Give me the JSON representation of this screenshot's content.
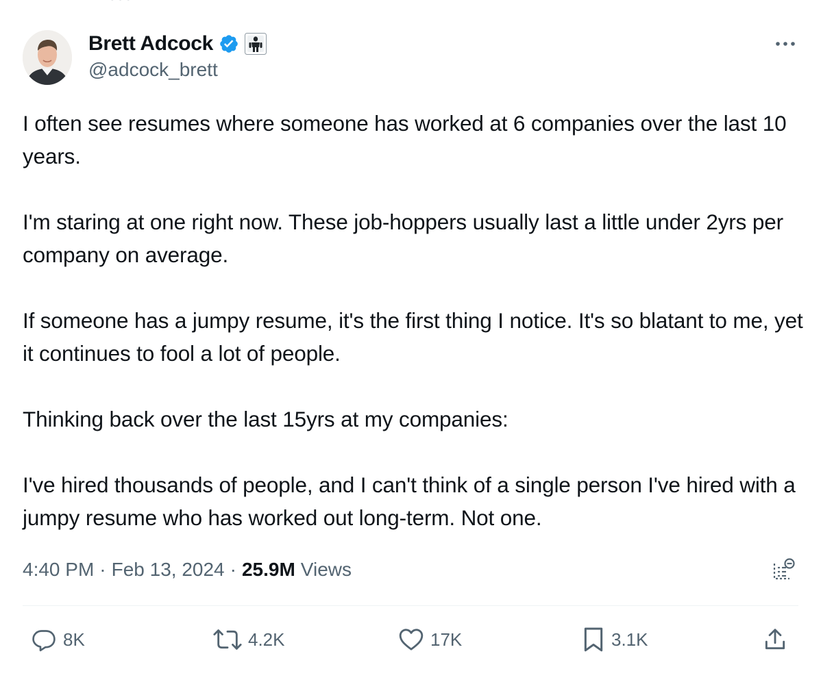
{
  "top_fragment": "•••",
  "author": {
    "display_name": "Brett Adcock",
    "handle": "@adcock_brett",
    "verified": true,
    "affiliate_badge": "robot-badge-icon"
  },
  "tweet": {
    "paragraphs": [
      "I often see resumes where someone has worked at 6 companies over the last 10 years.",
      "I'm staring at one right now. These job-hoppers usually last a little under 2yrs per company on average.",
      "If someone has a jumpy resume, it's the first thing I notice. It's so blatant to me, yet it continues to fool a lot of people.",
      "Thinking back over the last 15yrs at my companies:",
      "I've hired thousands of people, and I can't think of a single person I've hired with a jumpy resume who has worked out long-term. Not one."
    ]
  },
  "meta": {
    "time": "4:40 PM",
    "separator": "·",
    "date": "Feb 13, 2024",
    "views_count": "25.9M",
    "views_label": "Views"
  },
  "actions": {
    "replies": "8K",
    "reposts": "4.2K",
    "likes": "17K",
    "bookmarks": "3.1K"
  },
  "colors": {
    "text_primary": "#0f1419",
    "text_secondary": "#536471",
    "verified_blue": "#1d9bf0",
    "divider": "#eff3f4"
  },
  "icons": {
    "more": "more-horizontal-icon",
    "analytics": "analytics-icon",
    "reply": "reply-icon",
    "repost": "repost-icon",
    "like": "heart-icon",
    "bookmark": "bookmark-icon",
    "share": "share-icon"
  }
}
